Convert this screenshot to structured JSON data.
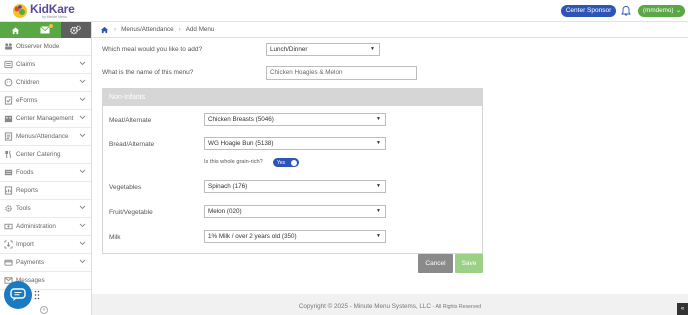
{
  "header": {
    "brand": "KidKare",
    "brand_tagline": "by Minute Menu",
    "sponsor_button": "Center Sponsor",
    "user_button": "(mmdemo)"
  },
  "sidebar": {
    "items": [
      {
        "label": "Observer Mode",
        "icon": "observer-icon",
        "chevron": false
      },
      {
        "label": "Claims",
        "icon": "claims-icon",
        "chevron": true
      },
      {
        "label": "Children",
        "icon": "children-icon",
        "chevron": true
      },
      {
        "label": "eForms",
        "icon": "eforms-icon",
        "chevron": true
      },
      {
        "label": "Center Management",
        "icon": "building-icon",
        "chevron": true
      },
      {
        "label": "Menus/Attendance",
        "icon": "menus-icon",
        "chevron": true
      },
      {
        "label": "Center Catering",
        "icon": "catering-icon",
        "chevron": false
      },
      {
        "label": "Foods",
        "icon": "foods-icon",
        "chevron": true
      },
      {
        "label": "Reports",
        "icon": "reports-icon",
        "chevron": false
      },
      {
        "label": "Tools",
        "icon": "tools-icon",
        "chevron": true
      },
      {
        "label": "Administration",
        "icon": "admin-icon",
        "chevron": true
      },
      {
        "label": "Import",
        "icon": "import-icon",
        "chevron": true
      },
      {
        "label": "Payments",
        "icon": "payments-icon",
        "chevron": true
      },
      {
        "label": "Messages",
        "icon": "messages-icon",
        "chevron": false
      }
    ]
  },
  "breadcrumb": {
    "items": [
      "Menus/Attendance",
      "Add Menu"
    ]
  },
  "form": {
    "meal_question": "Which meal would you like to add?",
    "meal_value": "Lunch/Dinner",
    "name_question": "What is the name of this menu?",
    "name_value": "Chicken Hoagies & Melon"
  },
  "panel": {
    "title": "Non-Infants",
    "rows": [
      {
        "label": "Meat/Alternate",
        "value": "Chicken Breasts (5046)"
      },
      {
        "label": "Bread/Alternate",
        "value": "WG Hoagie Bun (5138)"
      },
      {
        "label": "Vegetables",
        "value": "Spinach (176)"
      },
      {
        "label": "Fruit/Vegetable",
        "value": "Melon (020)"
      },
      {
        "label": "Milk",
        "value": "1% Milk / over 2 years old (350)"
      }
    ],
    "grain_question": "Is this whole grain-rich?",
    "grain_toggle": "Yes"
  },
  "buttons": {
    "cancel": "Cancel",
    "save": "Save"
  },
  "footer": {
    "copyright": "Copyright © 2025 - Minute Menu Systems, LLC",
    "rights": "- All Rights Reserved"
  },
  "colors": {
    "green": "#5aa845",
    "blue": "#2d55b7",
    "panel_header": "#d6d6d6"
  }
}
